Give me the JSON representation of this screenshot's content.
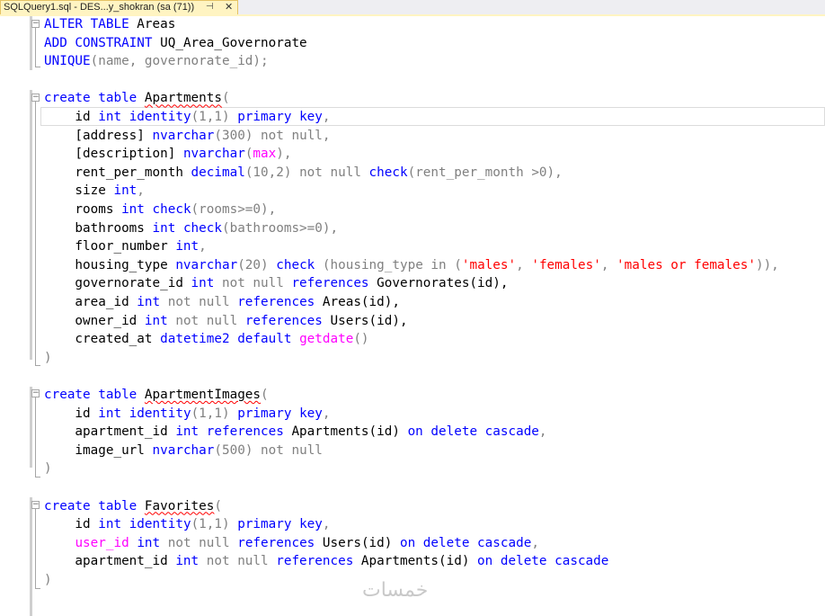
{
  "tab": {
    "title": "SQLQuery1.sql - DES...y_shokran (sa (71))",
    "pin_icon": "⊣",
    "close_icon": "✕"
  },
  "code_lines": [
    [
      [
        "ALTER TABLE",
        "kw"
      ],
      [
        " Areas",
        "bk"
      ]
    ],
    [
      [
        "ADD CONSTRAINT",
        "kw"
      ],
      [
        " UQ_Area_Governorate",
        "bk"
      ]
    ],
    [
      [
        "UNIQUE",
        "kw"
      ],
      [
        "(name, governorate_id);",
        "gy"
      ]
    ],
    [],
    [
      [
        "create table",
        "kw"
      ],
      [
        " ",
        "bk"
      ],
      [
        "Apartments",
        "sq"
      ],
      [
        "(",
        "gy"
      ]
    ],
    [
      [
        "    id ",
        "bk"
      ],
      [
        "int identity",
        "kw"
      ],
      [
        "(1,1) ",
        "gy"
      ],
      [
        "primary key",
        "kw"
      ],
      [
        ",",
        "gy"
      ]
    ],
    [
      [
        "    [address] ",
        "bk"
      ],
      [
        "nvarchar",
        "kw"
      ],
      [
        "(300) ",
        "gy"
      ],
      [
        "not null",
        "gy"
      ],
      [
        ",",
        "gy"
      ]
    ],
    [
      [
        "    [description] ",
        "bk"
      ],
      [
        "nvarchar",
        "kw"
      ],
      [
        "(",
        "gy"
      ],
      [
        "max",
        "mg"
      ],
      [
        "),",
        "gy"
      ]
    ],
    [
      [
        "    rent_per_month ",
        "bk"
      ],
      [
        "decimal",
        "kw"
      ],
      [
        "(10,2) ",
        "gy"
      ],
      [
        "not null ",
        "gy"
      ],
      [
        "check",
        "kw"
      ],
      [
        "(rent_per_month >0),",
        "gy"
      ]
    ],
    [
      [
        "    size ",
        "bk"
      ],
      [
        "int",
        "kw"
      ],
      [
        ",",
        "gy"
      ]
    ],
    [
      [
        "    rooms ",
        "bk"
      ],
      [
        "int check",
        "kw"
      ],
      [
        "(rooms>=0),",
        "gy"
      ]
    ],
    [
      [
        "    bathrooms ",
        "bk"
      ],
      [
        "int check",
        "kw"
      ],
      [
        "(bathrooms>=0),",
        "gy"
      ]
    ],
    [
      [
        "    floor_number ",
        "bk"
      ],
      [
        "int",
        "kw"
      ],
      [
        ",",
        "gy"
      ]
    ],
    [
      [
        "    housing_type ",
        "bk"
      ],
      [
        "nvarchar",
        "kw"
      ],
      [
        "(20) ",
        "gy"
      ],
      [
        "check",
        "kw"
      ],
      [
        " (housing_type ",
        "gy"
      ],
      [
        "in",
        "gy"
      ],
      [
        " (",
        "gy"
      ],
      [
        "'males'",
        "rd"
      ],
      [
        ", ",
        "gy"
      ],
      [
        "'females'",
        "rd"
      ],
      [
        ", ",
        "gy"
      ],
      [
        "'males or females'",
        "rd"
      ],
      [
        ")),",
        "gy"
      ]
    ],
    [
      [
        "    governorate_id ",
        "bk"
      ],
      [
        "int ",
        "kw"
      ],
      [
        "not null ",
        "gy"
      ],
      [
        "references",
        "kw"
      ],
      [
        " Governorates(id),",
        "bk"
      ]
    ],
    [
      [
        "    area_id ",
        "bk"
      ],
      [
        "int ",
        "kw"
      ],
      [
        "not null ",
        "gy"
      ],
      [
        "references",
        "kw"
      ],
      [
        " Areas(id),",
        "bk"
      ]
    ],
    [
      [
        "    owner_id ",
        "bk"
      ],
      [
        "int ",
        "kw"
      ],
      [
        "not null ",
        "gy"
      ],
      [
        "references",
        "kw"
      ],
      [
        " Users(id),",
        "bk"
      ]
    ],
    [
      [
        "    created_at ",
        "bk"
      ],
      [
        "datetime2 default ",
        "kw"
      ],
      [
        "getdate",
        "mg"
      ],
      [
        "()",
        "gy"
      ]
    ],
    [
      [
        ")",
        "gy"
      ]
    ],
    [],
    [
      [
        "create table",
        "kw"
      ],
      [
        " ",
        "bk"
      ],
      [
        "ApartmentImages",
        "sq"
      ],
      [
        "(",
        "gy"
      ]
    ],
    [
      [
        "    id ",
        "bk"
      ],
      [
        "int identity",
        "kw"
      ],
      [
        "(1,1) ",
        "gy"
      ],
      [
        "primary key",
        "kw"
      ],
      [
        ",",
        "gy"
      ]
    ],
    [
      [
        "    apartment_id ",
        "bk"
      ],
      [
        "int references",
        "kw"
      ],
      [
        " Apartments(id) ",
        "bk"
      ],
      [
        "on delete cascade",
        "kw"
      ],
      [
        ",",
        "gy"
      ]
    ],
    [
      [
        "    image_url ",
        "bk"
      ],
      [
        "nvarchar",
        "kw"
      ],
      [
        "(500) ",
        "gy"
      ],
      [
        "not null",
        "gy"
      ]
    ],
    [
      [
        ")",
        "gy"
      ]
    ],
    [],
    [
      [
        "create table",
        "kw"
      ],
      [
        " ",
        "bk"
      ],
      [
        "Favorites",
        "sq"
      ],
      [
        "(",
        "gy"
      ]
    ],
    [
      [
        "    id ",
        "bk"
      ],
      [
        "int identity",
        "kw"
      ],
      [
        "(1,1) ",
        "gy"
      ],
      [
        "primary key",
        "kw"
      ],
      [
        ",",
        "gy"
      ]
    ],
    [
      [
        "    ",
        "bk"
      ],
      [
        "user_id",
        "mg"
      ],
      [
        " ",
        "bk"
      ],
      [
        "int ",
        "kw"
      ],
      [
        "not null ",
        "gy"
      ],
      [
        "references",
        "kw"
      ],
      [
        " Users(id) ",
        "bk"
      ],
      [
        "on delete cascade",
        "kw"
      ],
      [
        ",",
        "gy"
      ]
    ],
    [
      [
        "    apartment_id ",
        "bk"
      ],
      [
        "int ",
        "kw"
      ],
      [
        "not null ",
        "gy"
      ],
      [
        "references",
        "kw"
      ],
      [
        " Apartments(id) ",
        "bk"
      ],
      [
        "on delete cascade",
        "kw"
      ]
    ],
    [
      [
        ")",
        "gy"
      ]
    ]
  ],
  "watermark": "خمسات"
}
